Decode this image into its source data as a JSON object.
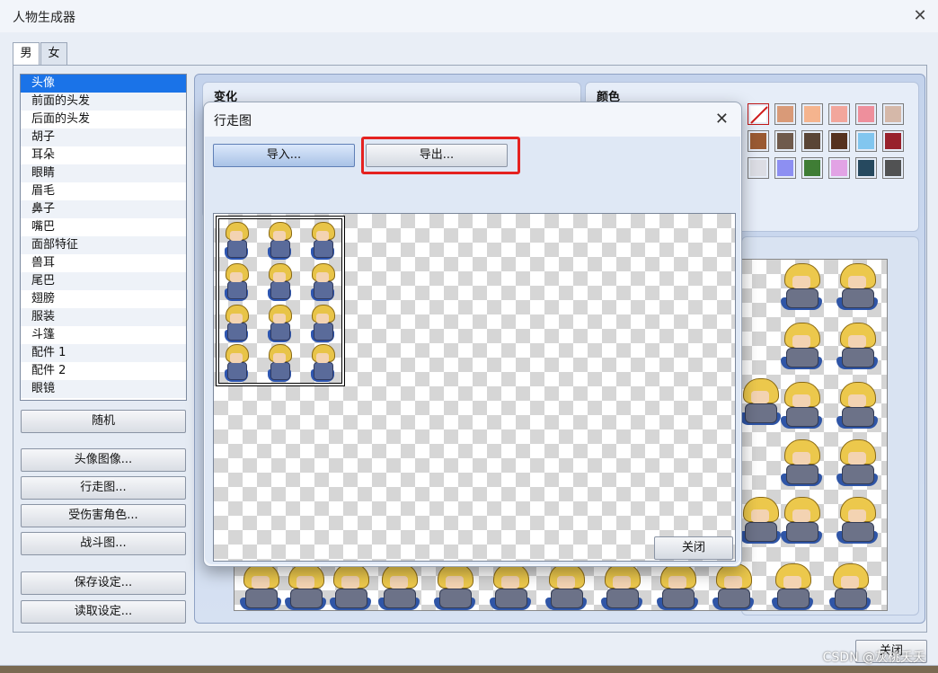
{
  "window": {
    "title": "人物生成器",
    "close_glyph": "✕"
  },
  "tabs": [
    {
      "label": "男",
      "active": true
    },
    {
      "label": "女",
      "active": false
    }
  ],
  "parts": {
    "selected": "头像",
    "items": [
      "头像",
      "前面的头发",
      "后面的头发",
      "胡子",
      "耳朵",
      "眼睛",
      "眉毛",
      "鼻子",
      "嘴巴",
      "面部特征",
      "兽耳",
      "尾巴",
      "翅膀",
      "服装",
      "斗篷",
      "配件 1",
      "配件 2",
      "眼镜"
    ]
  },
  "left_buttons": {
    "random": "随机",
    "face_image": "头像图像...",
    "walk_sheet": "行走图...",
    "damage_char": "受伤害角色...",
    "battle_sheet": "战斗图...",
    "save_settings": "保存设定...",
    "load_settings": "读取设定..."
  },
  "groups": {
    "variation": "变化",
    "color": "颜色"
  },
  "colors": {
    "palette": [
      "none",
      "#d99a78",
      "#f5b48e",
      "#f2a69c",
      "#ee8f9c",
      "#d5b8a9",
      "#9a5a32",
      "#6f5a4c",
      "#5a4536",
      "#56311e",
      "#82c6ef",
      "#98212c",
      "#dcdde4",
      "#8d8ff2",
      "#3f7d35",
      "#e2a3e5",
      "#26495f",
      "#515253"
    ]
  },
  "dialog": {
    "title": "行走图",
    "close_glyph": "✕",
    "import_label": "导入...",
    "export_label": "导出...",
    "close_label": "关闭"
  },
  "footer": {
    "close_label": "关闭"
  },
  "watermark": "CSDN @灰桃夭夭"
}
